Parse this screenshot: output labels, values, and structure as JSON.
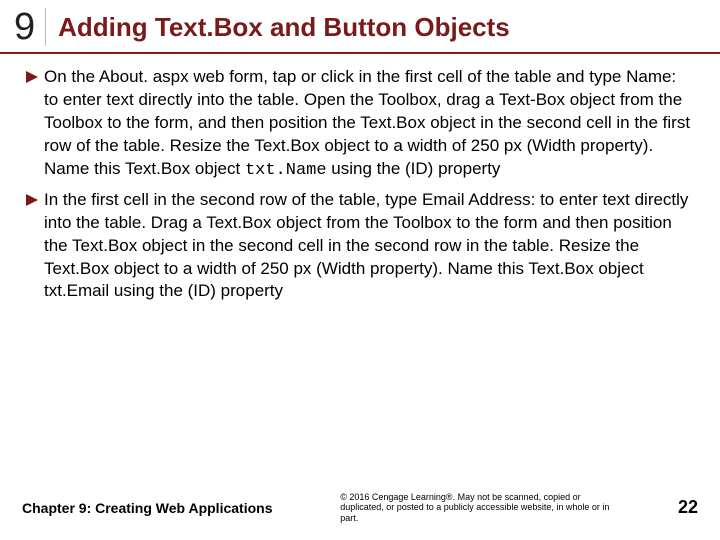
{
  "header": {
    "chapter_number": "9",
    "title": "Adding Text.Box and Button Objects"
  },
  "bullets": [
    {
      "text_pre": "On the About. aspx web form, tap or click in the first cell of the table and type Name: to enter text directly into the table. Open the Toolbox, drag a Text-Box object from the Toolbox to the form, and then position the Text.Box object in the second cell in the first row of the table. Resize the Text.Box object to a width of 250 px (Width property). Name this Text.Box object ",
      "code": "txt.Name",
      "text_post": " using the (ID) property"
    },
    {
      "text_pre": "In the first cell in the second row of the table, type Email Address: to enter text directly into the table. Drag a Text.Box object from the Toolbox to the form and then position the Text.Box object in the second cell in the second row in the table. Resize the Text.Box object to a width of 250 px (Width property). Name this Text.Box object txt.Email using the (ID) property",
      "code": "",
      "text_post": ""
    }
  ],
  "footer": {
    "chapter_label": "Chapter 9: Creating Web Applications",
    "copyright": "© 2016 Cengage Learning®. May not be scanned, copied or duplicated, or posted to a publicly accessible website, in whole or in part.",
    "page_number": "22"
  }
}
